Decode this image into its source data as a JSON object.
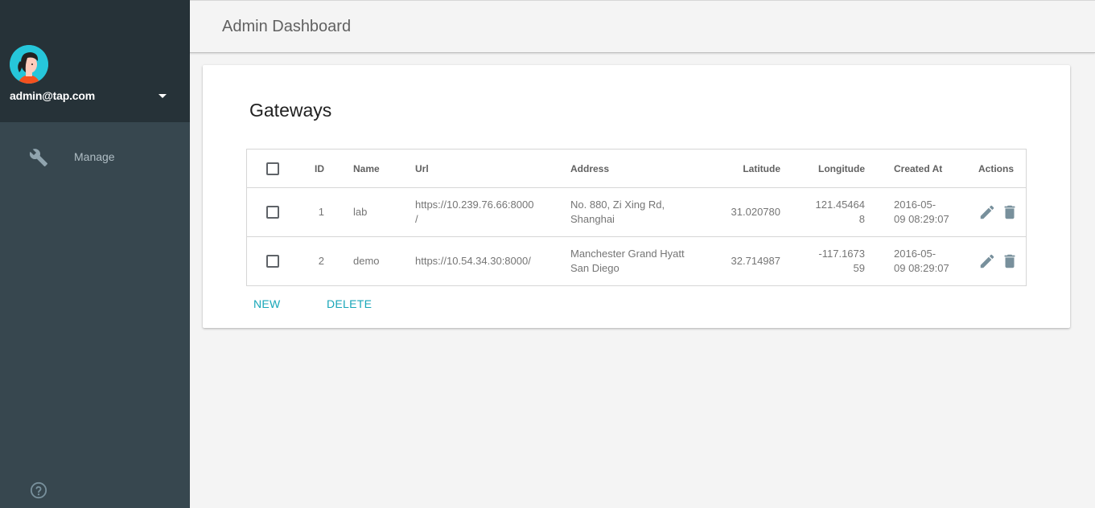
{
  "sidebar": {
    "user_email": "admin@tap.com",
    "nav_items": [
      {
        "label": "Manage",
        "icon": "wrench-icon"
      }
    ],
    "help_icon": "help-icon"
  },
  "header": {
    "title": "Admin Dashboard"
  },
  "card": {
    "title": "Gateways",
    "table": {
      "columns": [
        "ID",
        "Name",
        "Url",
        "Address",
        "Latitude",
        "Longitude",
        "Created At",
        "Actions"
      ],
      "rows": [
        {
          "id": "1",
          "name": "lab",
          "url_line1": "https://10.239.76.66:8000",
          "url_line2": "/",
          "address_line1": "No. 880, Zi Xing Rd,",
          "address_line2": "Shanghai",
          "latitude": "31.020780",
          "longitude_line1": "121.45464",
          "longitude_line2": "8",
          "created_line1": "2016-05-",
          "created_line2": "09 08:29:07"
        },
        {
          "id": "2",
          "name": "demo",
          "url_line1": "https://10.54.34.30:8000/",
          "url_line2": "",
          "address_line1": "Manchester Grand Hyatt",
          "address_line2": "San Diego",
          "latitude": "32.714987",
          "longitude_line1": "-117.1673",
          "longitude_line2": "59",
          "created_line1": "2016-05-",
          "created_line2": "09 08:29:07"
        }
      ]
    },
    "buttons": {
      "new": "NEW",
      "delete": "DELETE"
    }
  },
  "colors": {
    "sidebar_bg": "#37474f",
    "sidebar_header_bg": "#263238",
    "accent": "#17a6b8",
    "avatar_bg": "#26c6da"
  }
}
